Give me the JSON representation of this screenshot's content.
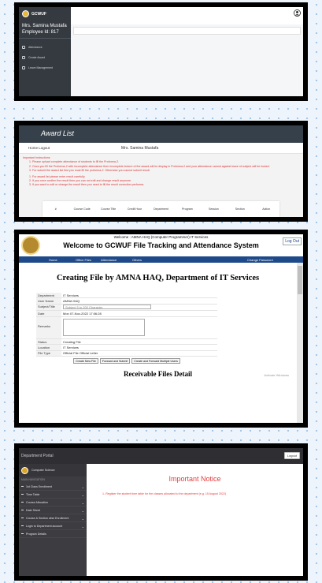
{
  "panel1": {
    "logo_text": "GCWUF",
    "user_name": "Mrs. Samina Mustafa",
    "employee_id": "Employee Id: 817",
    "nav": [
      "Attendance",
      "Create Award",
      "Leave Management"
    ]
  },
  "panel2": {
    "header_title": "Award List",
    "breadcrumb": "Home   Logout",
    "user_name": "Mrs. Samina Mustafa",
    "notice_heading": "Important Instructions",
    "instructions": [
      "Please upload complete attendance of students to fill the Proforma-2.",
      "Once you fill the Proforma-2 with incomplete attendance then incomplete lecture of the award will be display in Proforma-2 and your attendance cannot against leave of subject will be locked.",
      "For submit the award list first you must fill the proforma-2. Otherwise you cannot submit result.",
      "For award list please enter result carefully.",
      "If you once confirm the result then you can not edit and change result anymore.",
      "If you want to edit or change the result then you need to fill the result correction performa."
    ],
    "table_headers": [
      "#",
      "Course Code",
      "Course Title",
      "Credit Hour",
      "Department",
      "Program",
      "Session",
      "Section",
      "Action"
    ]
  },
  "panel3": {
    "welcome_small": "Welcome : AMNA HAQ (Computer Programmer) IT Services",
    "welcome_big": "Welcome to GCWUF File Tracking and Attendance System",
    "logout": "Log Out",
    "menu": {
      "home": "Home",
      "office_files": "Office Files",
      "attendance": "Attendance",
      "others": "Others",
      "change_password": "Change Password"
    },
    "page_title": "Creating File by AMNA HAQ, Department of IT Services",
    "form": {
      "dept_label": "Department",
      "dept_value": "IT Services",
      "user_label": "User Name",
      "user_value": "AMNA HAQ",
      "subject_label": "Subject/Title",
      "subject_placeholder": "Subject 5 to 200 Character",
      "date_label": "Date",
      "date_value": "Mon 07-Nov-2022 17:06:28",
      "remarks_label": "Remarks",
      "status_label": "Status",
      "status_value": "Creating File",
      "location_label": "Location",
      "location_value": "IT Services",
      "filetype_label": "File Type",
      "filetype_options": "Official File   Official Letter",
      "buttons": [
        "Create New File",
        "Forward and Submit",
        "Create and Forward Multiple Users"
      ]
    },
    "receivable_title": "Receivable Files Detail",
    "activate_windows": "Activate Windows"
  },
  "panel4": {
    "brand": "Department Portal",
    "logout": "Logout",
    "profile_name": "Computer Science",
    "section": "MAIN NAVIGATION",
    "nav": [
      "1st Class Enrollment",
      "Time Table",
      "Course Allocation",
      "Date Sheet",
      "Course & Section wise Enrollment",
      "Login to Department account",
      "Program Details"
    ],
    "notice_title": "Important Notice",
    "notice_message": "1- Register the student time table for the classes allocated to the department (e.g. 15 August 2022)"
  }
}
